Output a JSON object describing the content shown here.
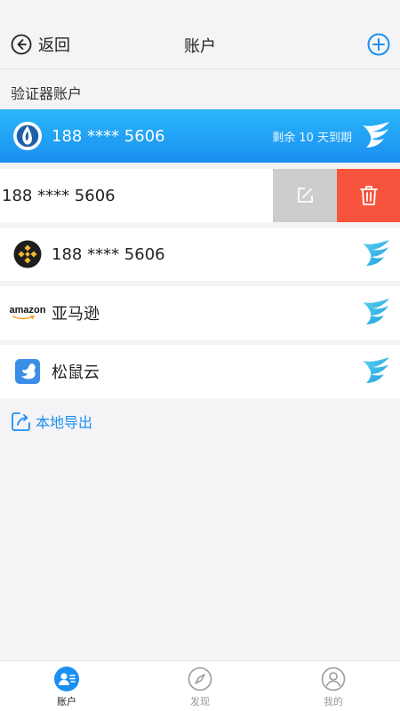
{
  "header": {
    "back_label": "返回",
    "title": "账户"
  },
  "section_label": "验证器账户",
  "accounts": [
    {
      "name": "188 **** 5606",
      "expiry": "剩余 10 天到期",
      "icon": "huawei-cloud-icon"
    },
    {
      "name": "188 **** 5606",
      "icon": ""
    },
    {
      "name": "188 **** 5606",
      "icon": "binance-icon"
    },
    {
      "name": "亚马逊",
      "icon": "amazon-icon",
      "logo_text": "amazon"
    },
    {
      "name": "松鼠云",
      "icon": "squirrel-icon"
    }
  ],
  "swipe_actions": {
    "edit_icon": "edit-icon",
    "delete_icon": "trash-icon"
  },
  "export_label": "本地导出",
  "tabs": [
    {
      "label": "账户",
      "icon": "account-icon",
      "active": true
    },
    {
      "label": "发现",
      "icon": "compass-icon",
      "active": false
    },
    {
      "label": "我的",
      "icon": "user-icon",
      "active": false
    }
  ],
  "colors": {
    "accent": "#1a8ff2",
    "gradient_top": "#2ab7f8",
    "delete_red": "#f7533d",
    "edit_gray": "#cdcdcd",
    "background": "#f4f4f6"
  }
}
